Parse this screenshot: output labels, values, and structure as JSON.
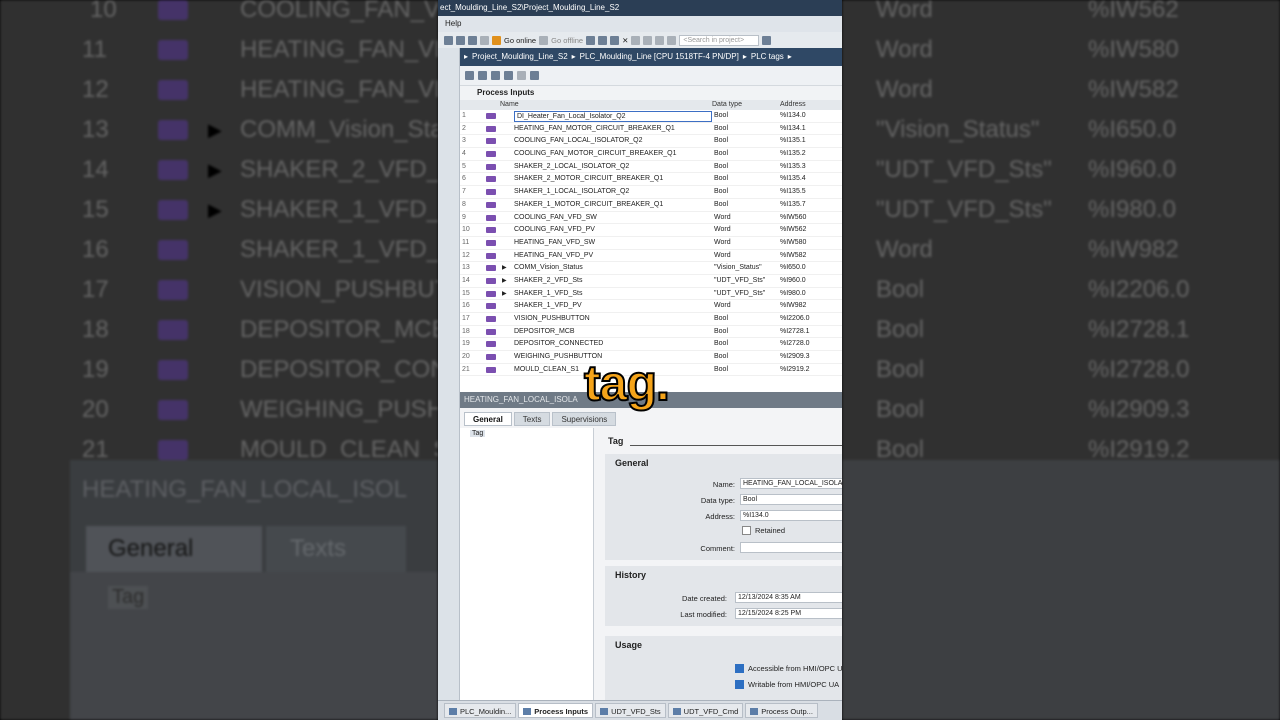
{
  "app": {
    "title": "ect_Moulding_Line_S2\\Project_Moulding_Line_S2",
    "menu": {
      "help": "Help"
    },
    "toolbar": {
      "go_online": "Go online",
      "go_offline": "Go offline",
      "search_placeholder": "<Search in project>"
    },
    "breadcrumb": [
      "Project_Moulding_Line_S2",
      "PLC_Moulding_Line [CPU 1518TF-4 PN/DP]",
      "PLC tags"
    ]
  },
  "tag_table": {
    "title": "Process Inputs",
    "columns": [
      "Name",
      "Data type",
      "Address"
    ],
    "rows": [
      {
        "num": "1",
        "name": "DI_Heater_Fan_Local_Isolator_Q2",
        "dtype": "Bool",
        "addr": "%I134.0",
        "selected": true
      },
      {
        "num": "2",
        "name": "HEATING_FAN_MOTOR_CIRCUIT_BREAKER_Q1",
        "dtype": "Bool",
        "addr": "%I134.1"
      },
      {
        "num": "3",
        "name": "COOLING_FAN_LOCAL_ISOLATOR_Q2",
        "dtype": "Bool",
        "addr": "%I135.1"
      },
      {
        "num": "4",
        "name": "COOLING_FAN_MOTOR_CIRCUIT_BREAKER_Q1",
        "dtype": "Bool",
        "addr": "%I135.2"
      },
      {
        "num": "5",
        "name": "SHAKER_2_LOCAL_ISOLATOR_Q2",
        "dtype": "Bool",
        "addr": "%I135.3"
      },
      {
        "num": "6",
        "name": "SHAKER_2_MOTOR_CIRCUIT_BREAKER_Q1",
        "dtype": "Bool",
        "addr": "%I135.4"
      },
      {
        "num": "7",
        "name": "SHAKER_1_LOCAL_ISOLATOR_Q2",
        "dtype": "Bool",
        "addr": "%I135.5"
      },
      {
        "num": "8",
        "name": "SHAKER_1_MOTOR_CIRCUIT_BREAKER_Q1",
        "dtype": "Bool",
        "addr": "%I135.7"
      },
      {
        "num": "9",
        "name": "COOLING_FAN_VFD_SW",
        "dtype": "Word",
        "addr": "%IW560"
      },
      {
        "num": "10",
        "name": "COOLING_FAN_VFD_PV",
        "dtype": "Word",
        "addr": "%IW562"
      },
      {
        "num": "11",
        "name": "HEATING_FAN_VFD_SW",
        "dtype": "Word",
        "addr": "%IW580"
      },
      {
        "num": "12",
        "name": "HEATING_FAN_VFD_PV",
        "dtype": "Word",
        "addr": "%IW582"
      },
      {
        "num": "13",
        "name": "COMM_Vision_Status",
        "dtype": "\"Vision_Status\"",
        "addr": "%I650.0",
        "expand": true
      },
      {
        "num": "14",
        "name": "SHAKER_2_VFD_Sts",
        "dtype": "\"UDT_VFD_Sts\"",
        "addr": "%I960.0",
        "expand": true
      },
      {
        "num": "15",
        "name": "SHAKER_1_VFD_Sts",
        "dtype": "\"UDT_VFD_Sts\"",
        "addr": "%I980.0",
        "expand": true
      },
      {
        "num": "16",
        "name": "SHAKER_1_VFD_PV",
        "dtype": "Word",
        "addr": "%IW982"
      },
      {
        "num": "17",
        "name": "VISION_PUSHBUTTON",
        "dtype": "Bool",
        "addr": "%I2206.0"
      },
      {
        "num": "18",
        "name": "DEPOSITOR_MCB",
        "dtype": "Bool",
        "addr": "%I2728.1"
      },
      {
        "num": "19",
        "name": "DEPOSITOR_CONNECTED",
        "dtype": "Bool",
        "addr": "%I2728.0"
      },
      {
        "num": "20",
        "name": "WEIGHING_PUSHBUTTON",
        "dtype": "Bool",
        "addr": "%I2909.3"
      },
      {
        "num": "21",
        "name": "MOULD_CLEAN_S1",
        "dtype": "Bool",
        "addr": "%I2919.2"
      }
    ]
  },
  "properties": {
    "header": "HEATING_FAN_LOCAL_ISOLA",
    "tabs": [
      "General",
      "Texts",
      "Supervisions"
    ],
    "tree_item": "Tag",
    "section_tag": "Tag",
    "general": {
      "title": "General",
      "name_label": "Name:",
      "name_value": "HEATING_FAN_LOCAL_ISOLA",
      "dtype_label": "Data type:",
      "dtype_value": "Bool",
      "address_label": "Address:",
      "address_value": "%I134.0",
      "retained_label": "Retained",
      "comment_label": "Comment:"
    },
    "history": {
      "title": "History",
      "created_label": "Date created:",
      "created_value": "12/13/2024 8:35 AM",
      "modified_label": "Last modified:",
      "modified_value": "12/15/2024 8:25 PM"
    },
    "usage": {
      "title": "Usage",
      "accessible": "Accessible from HMI/OPC UA",
      "writable": "Writable from HMI/OPC UA"
    }
  },
  "editor_bar": [
    "PLC_Mouldin...",
    "Process Inputs",
    "UDT_VFD_Sts",
    "UDT_VFD_Cmd",
    "Process Outp..."
  ],
  "background": {
    "rows": [
      {
        "num": "10",
        "name": "COOLING_FAN_V",
        "dtype": "Word",
        "addr": "%IW562"
      },
      {
        "num": "11",
        "name": "HEATING_FAN_VF",
        "dtype": "Word",
        "addr": "%IW580"
      },
      {
        "num": "12",
        "name": "HEATING_FAN_VF",
        "dtype": "Word",
        "addr": "%IW582"
      },
      {
        "num": "13",
        "name": "COMM_Vision_Sta",
        "dtype": "\"Vision_Status\"",
        "addr": "%I650.0"
      },
      {
        "num": "14",
        "name": "SHAKER_2_VFD_S",
        "dtype": "\"UDT_VFD_Sts\"",
        "addr": "%I960.0"
      },
      {
        "num": "15",
        "name": "SHAKER_1_VFD_S",
        "dtype": "\"UDT_VFD_Sts\"",
        "addr": "%I980.0"
      },
      {
        "num": "16",
        "name": "SHAKER_1_VFD_P",
        "dtype": "Word",
        "addr": "%IW982"
      },
      {
        "num": "17",
        "name": "VISION_PUSHBUT",
        "dtype": "Bool",
        "addr": "%I2206.0"
      },
      {
        "num": "18",
        "name": "DEPOSITOR_MCB",
        "dtype": "Bool",
        "addr": "%I2728.1"
      },
      {
        "num": "19",
        "name": "DEPOSITOR_CONN",
        "dtype": "Bool",
        "addr": "%I2728.0"
      },
      {
        "num": "20",
        "name": "WEIGHING_PUSHB",
        "dtype": "Bool",
        "addr": "%I2909.3"
      },
      {
        "num": "21",
        "name": "MOULD_CLEAN_S",
        "dtype": "Bool",
        "addr": "%I2919.2"
      }
    ],
    "props_title": "HEATING_FAN_LOCAL_ISOL",
    "tab_general": "General",
    "tab_texts": "Texts",
    "tree_tag": "Tag"
  },
  "caption": "tag."
}
